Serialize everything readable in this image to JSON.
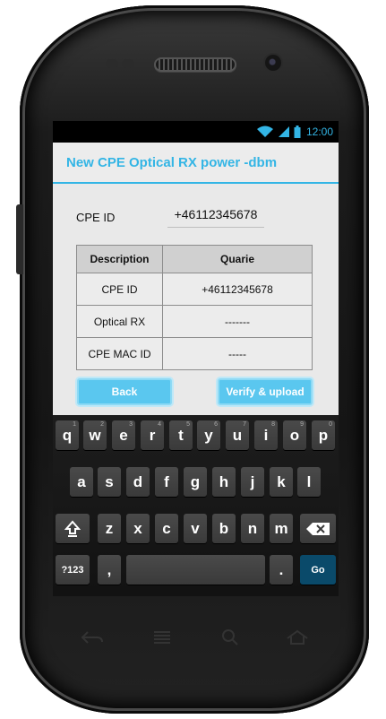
{
  "status_bar": {
    "time": "12:00"
  },
  "app": {
    "title": "New CPE Optical RX power -dbm"
  },
  "form": {
    "cpe_id_label": "CPE ID",
    "cpe_id_value": "+46112345678"
  },
  "table": {
    "headers": [
      "Description",
      "Quarie"
    ],
    "rows": [
      [
        "CPE ID",
        "+46112345678"
      ],
      [
        "Optical RX",
        "-------"
      ],
      [
        "CPE MAC ID",
        "-----"
      ]
    ]
  },
  "buttons": {
    "back": "Back",
    "verify_upload": "Verify & upload"
  },
  "keyboard": {
    "row1": [
      "q",
      "w",
      "e",
      "r",
      "t",
      "y",
      "u",
      "i",
      "o",
      "p"
    ],
    "row1_hints": [
      "1",
      "2",
      "3",
      "4",
      "5",
      "6",
      "7",
      "8",
      "9",
      "0"
    ],
    "row2": [
      "a",
      "s",
      "d",
      "f",
      "g",
      "h",
      "j",
      "k",
      "l"
    ],
    "row3": [
      "z",
      "x",
      "c",
      "v",
      "b",
      "n",
      "m"
    ],
    "symbols_key": "?123",
    "comma_key": ",",
    "period_key": ".",
    "go_key": "Go"
  },
  "colors": {
    "accent": "#33b5e5",
    "button": "#5ac7ef"
  }
}
